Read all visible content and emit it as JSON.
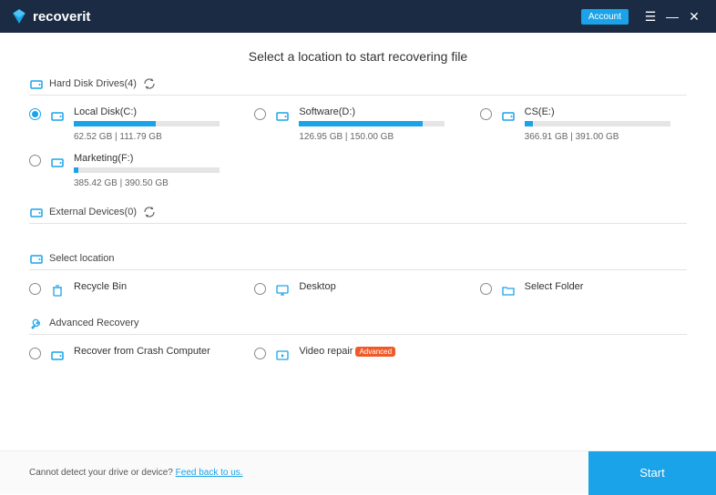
{
  "brand": "recoverit",
  "account_label": "Account",
  "page_title": "Select a location to start recovering file",
  "sections": {
    "hdd": {
      "title": "Hard Disk Drives(4)"
    },
    "ext": {
      "title": "External Devices(0)"
    },
    "loc": {
      "title": "Select location"
    },
    "adv": {
      "title": "Advanced Recovery"
    }
  },
  "drives": [
    {
      "name": "Local Disk(C:)",
      "used": "62.52",
      "total": "111.79",
      "unit": "GB",
      "pct": 56,
      "selected": true
    },
    {
      "name": "Software(D:)",
      "used": "126.95",
      "total": "150.00",
      "unit": "GB",
      "pct": 85,
      "selected": false
    },
    {
      "name": "CS(E:)",
      "used": "366.91",
      "total": "391.00",
      "unit": "GB",
      "pct": 6,
      "selected": false
    },
    {
      "name": "Marketing(F:)",
      "used": "385.42",
      "total": "390.50",
      "unit": "GB",
      "pct": 3,
      "selected": false
    }
  ],
  "locations": [
    {
      "name": "Recycle Bin",
      "icon": "trash"
    },
    {
      "name": "Desktop",
      "icon": "desktop"
    },
    {
      "name": "Select Folder",
      "icon": "folder"
    }
  ],
  "advanced": [
    {
      "name": "Recover from Crash Computer",
      "icon": "drive",
      "badge": null
    },
    {
      "name": "Video repair",
      "icon": "video",
      "badge": "Advanced"
    }
  ],
  "footer": {
    "text": "Cannot detect your drive or device? ",
    "link": "Feed back to us."
  },
  "start_label": "Start",
  "colors": {
    "accent": "#1aa3e8",
    "badge": "#f05a28",
    "titlebar": "#1b2b44"
  }
}
